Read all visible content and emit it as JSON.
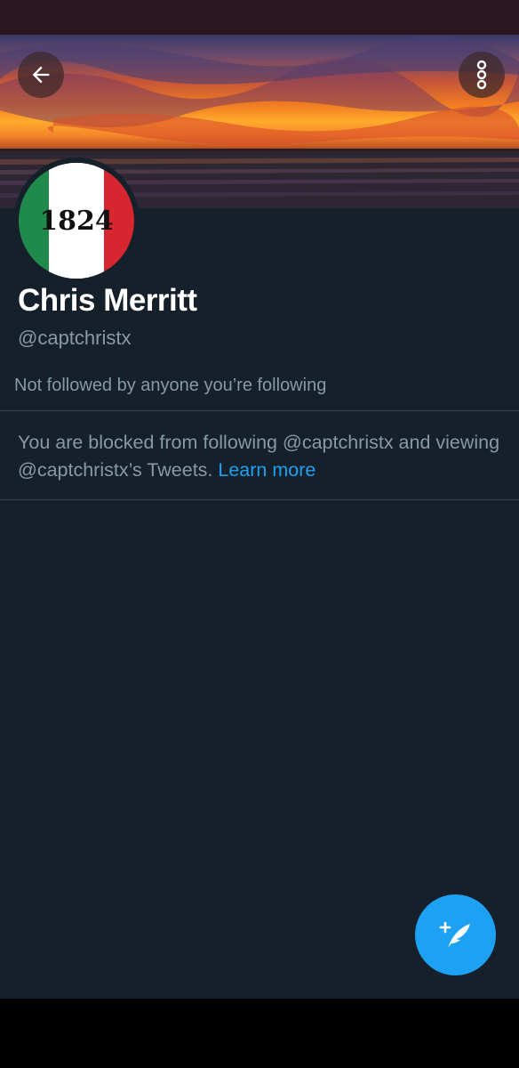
{
  "profile": {
    "display_name": "Chris Merritt",
    "handle": "@captchristx",
    "avatar_text": "1824",
    "followed_by": "Not followed by anyone you’re following"
  },
  "blocked": {
    "message": "You are blocked from following @captchristx and viewing @captchristx’s Tweets.",
    "link_label": "Learn more"
  },
  "icons": {
    "back": "arrow-left-icon",
    "more": "more-vertical-icon",
    "compose": "compose-tweet-icon"
  },
  "colors": {
    "background": "#15202b",
    "accent": "#1da1f2",
    "secondary_text": "#8899a6",
    "divider": "#38444d"
  }
}
